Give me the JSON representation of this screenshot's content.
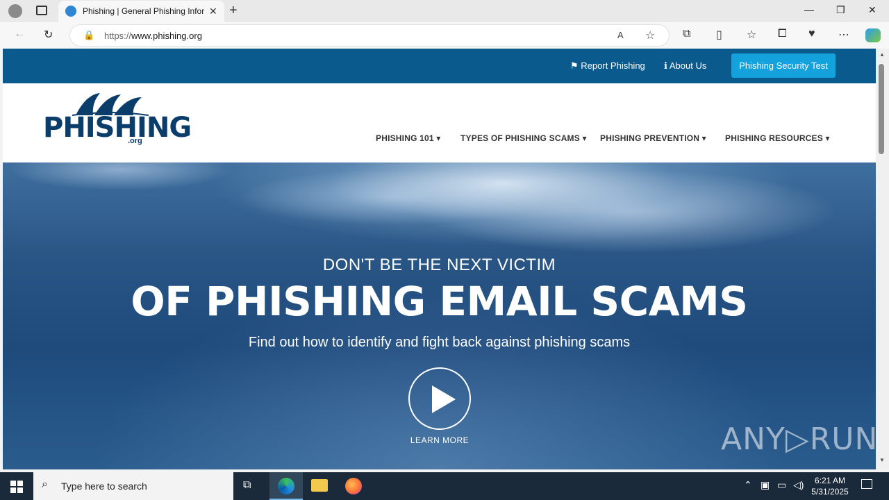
{
  "browser": {
    "tab_title": "Phishing | General Phishing Infor",
    "url_prefix": "https://",
    "url_domain": "www.phishing.org",
    "new_tab": "+",
    "tab_close": "✕"
  },
  "site": {
    "topnav": {
      "report": "Report Phishing",
      "about": "About Us",
      "security_test": "Phishing Security Test"
    },
    "logo": {
      "text": "PHISHING",
      "suffix": ".org"
    },
    "mainnav": [
      {
        "label": "PHISHING 101 ▾"
      },
      {
        "label": "TYPES OF PHISHING SCAMS ▾"
      },
      {
        "label": "PHISHING PREVENTION ▾"
      },
      {
        "label": "PHISHING RESOURCES ▾"
      }
    ],
    "hero": {
      "kicker": "DON'T BE THE NEXT VICTIM",
      "headline": "OF PHISHING EMAIL SCAMS",
      "subtitle": "Find out how to identify and fight back against phishing scams",
      "cta": "LEARN MORE"
    },
    "watermark": "ANY▷RUN"
  },
  "taskbar": {
    "search_placeholder": "Type here to search",
    "time": "6:21 AM",
    "date": "5/31/2025"
  },
  "colors": {
    "topnav_bg": "#0b5a8e",
    "security_btn": "#13a2db",
    "logo_navy": "#0b3d6a"
  }
}
